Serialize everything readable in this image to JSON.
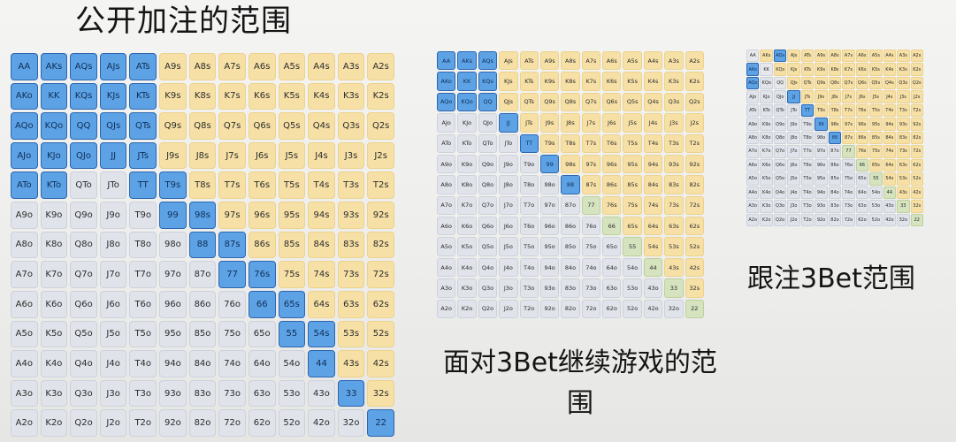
{
  "titles": {
    "open_raise": "公开加注的范围",
    "continue_vs_3bet": "面对3Bet继续游戏的范围",
    "call_3bet": "跟注3Bet范围"
  },
  "ranks": [
    "A",
    "K",
    "Q",
    "J",
    "T",
    "9",
    "8",
    "7",
    "6",
    "5",
    "4",
    "3",
    "2"
  ],
  "colors": {
    "selected": "#5da2e5",
    "selected_border": "#2c66b0",
    "suited": "#f6e0a6",
    "offsuit": "#e0e3ea",
    "pair": "#e6e8ec",
    "mixed": "#d5e3bf"
  },
  "charts": [
    {
      "id": "open",
      "legend_value": "公开加注的范围",
      "selected": [
        "AA",
        "AKs",
        "AQs",
        "AJs",
        "ATs",
        "AKo",
        "KK",
        "KQs",
        "KJs",
        "KTs",
        "AQo",
        "KQo",
        "QQ",
        "QJs",
        "QTs",
        "AJo",
        "KJo",
        "QJo",
        "JJ",
        "JTs",
        "ATo",
        "KTo",
        "TT",
        "T9s",
        "99",
        "98s",
        "88",
        "87s",
        "77",
        "76s",
        "66",
        "65s",
        "55",
        "54s",
        "44",
        "33",
        "22"
      ],
      "mixed": []
    },
    {
      "id": "cont",
      "legend_value": "面对3Bet继续游戏的范围",
      "selected": [
        "AA",
        "AKs",
        "AQs",
        "AKo",
        "KK",
        "KQs",
        "AQo",
        "KQo",
        "QQ",
        "JJ",
        "TT",
        "99",
        "88"
      ],
      "mixed": [
        "77",
        "66",
        "55",
        "44",
        "33",
        "22"
      ]
    },
    {
      "id": "call",
      "legend_value": "跟注3Bet范围",
      "selected": [
        "AQs",
        "AKo",
        "AQo",
        "JJ",
        "TT",
        "99",
        "88"
      ],
      "mixed": [
        "77",
        "66",
        "55",
        "44",
        "33",
        "22"
      ]
    }
  ]
}
